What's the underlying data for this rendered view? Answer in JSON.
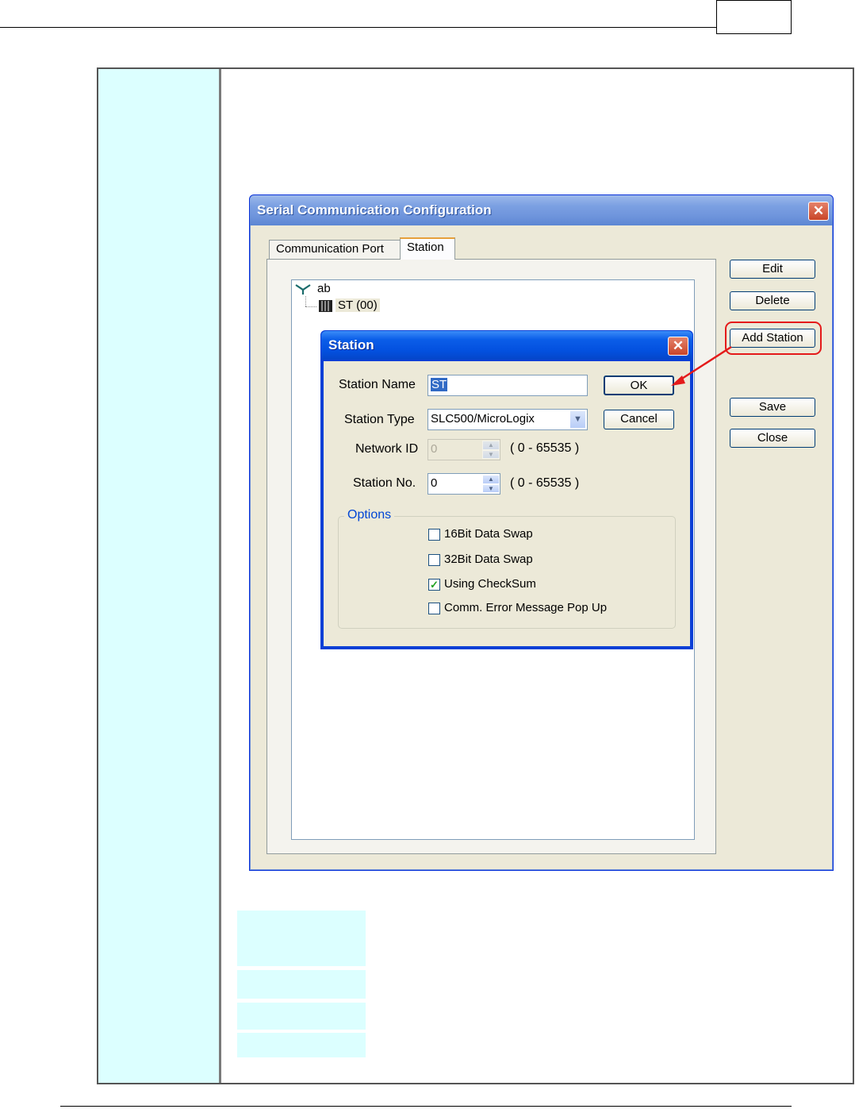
{
  "window": {
    "title": "Serial Communication Configuration",
    "close_glyph": "✕",
    "tabs": [
      {
        "label": "Communication Port",
        "active": false
      },
      {
        "label": "Station",
        "active": true
      }
    ],
    "tree": {
      "root_label": "ab",
      "child_label": "ST (00)"
    },
    "buttons": {
      "edit": "Edit",
      "delete": "Delete",
      "add_station": "Add Station",
      "save": "Save",
      "close": "Close"
    }
  },
  "station_dialog": {
    "title": "Station",
    "close_glyph": "✕",
    "station_name_label": "Station Name",
    "station_name_value": "ST",
    "station_type_label": "Station Type",
    "station_type_value": "SLC500/MicroLogix",
    "network_id_label": "Network ID",
    "network_id_value": "0",
    "network_id_range": "( 0 - 65535 )",
    "station_no_label": "Station No.",
    "station_no_value": "0",
    "station_no_range": "( 0 - 65535 )",
    "ok_label": "OK",
    "cancel_label": "Cancel",
    "options": {
      "label": "Options",
      "items": [
        {
          "label": "16Bit Data Swap",
          "checked": false
        },
        {
          "label": "32Bit Data Swap",
          "checked": false
        },
        {
          "label": "Using CheckSum",
          "checked": true
        },
        {
          "label": "Comm. Error Message Pop Up",
          "checked": false
        }
      ]
    }
  },
  "colors": {
    "cell_blue": "#dcffff",
    "xp_face": "#ece9d8",
    "highlight_red": "#e41a1a"
  }
}
